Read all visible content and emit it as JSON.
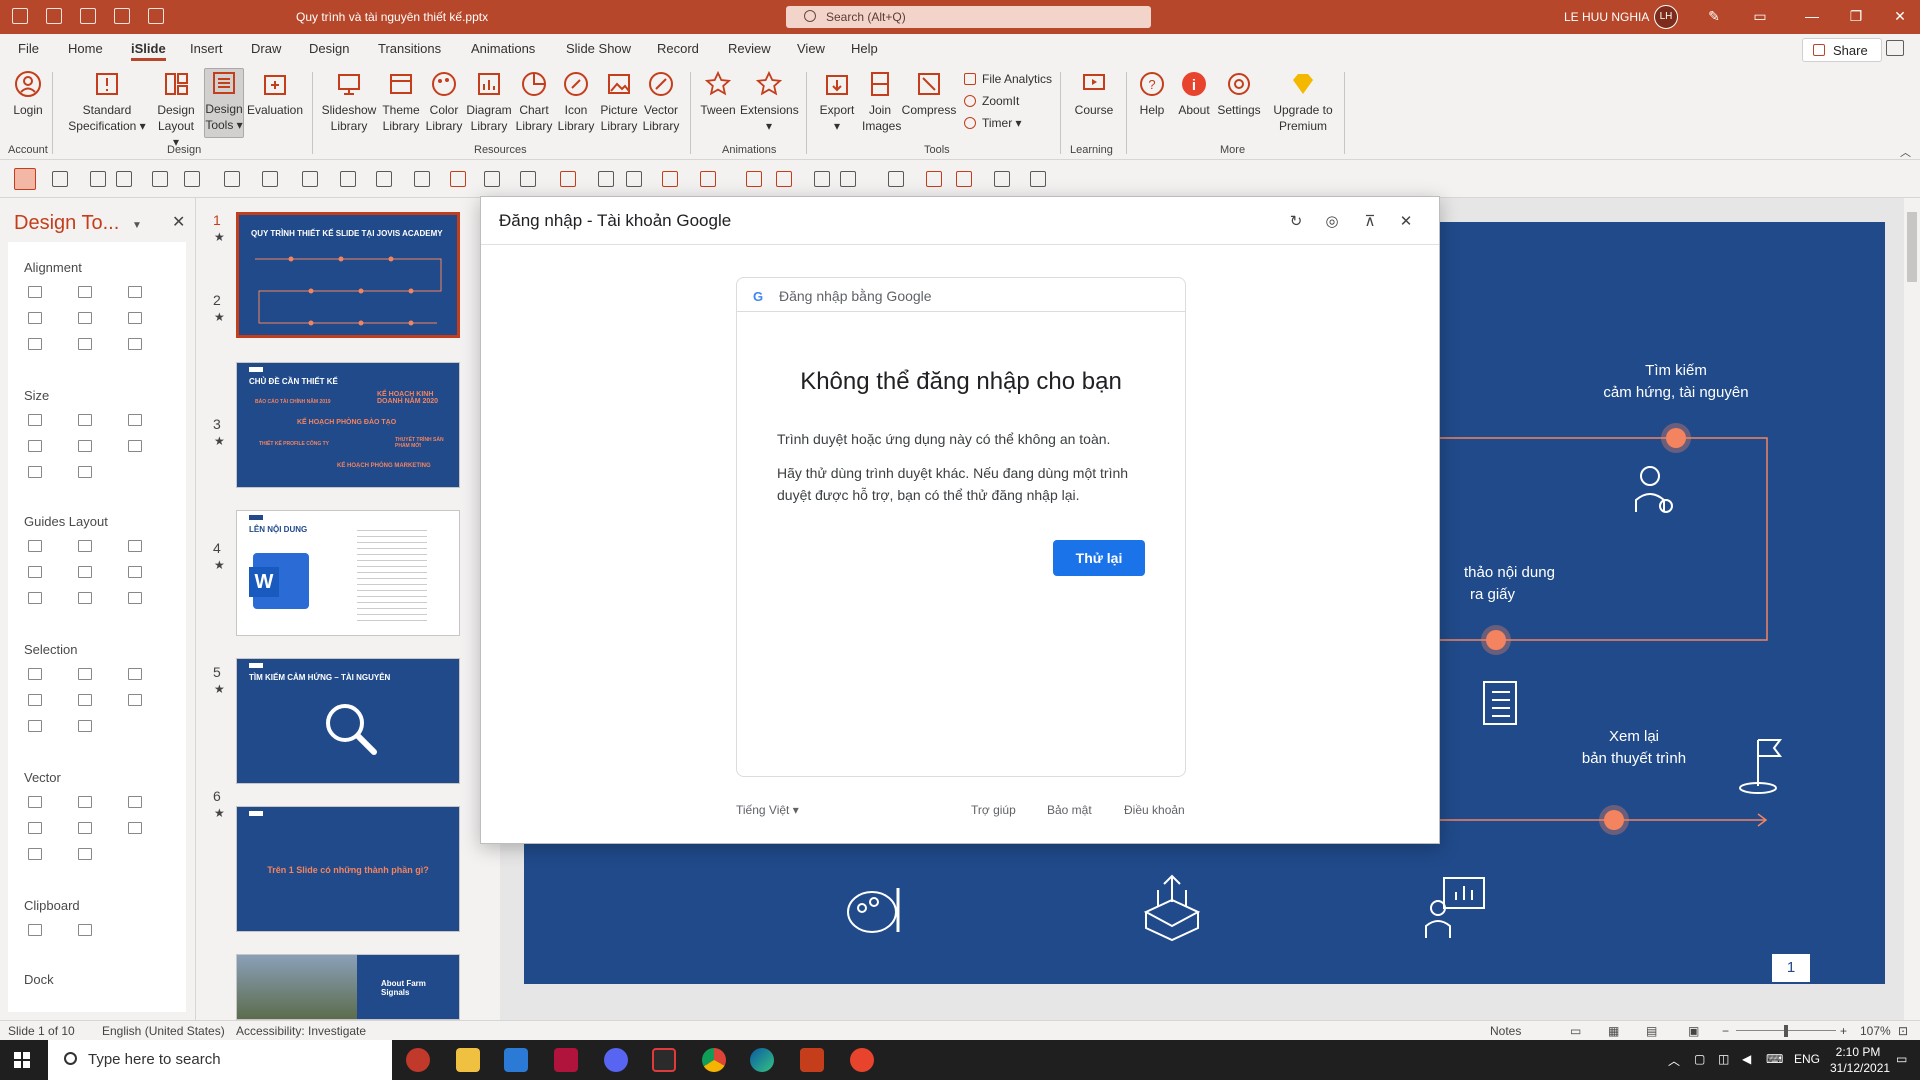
{
  "titlebar": {
    "doc_title": "Quy trình và tài nguyên thiết kế.pptx",
    "search_placeholder": "Search (Alt+Q)",
    "user_name": "LE HUU NGHIA",
    "user_initials": "LH",
    "brand_color": "#b7472a"
  },
  "tabs": [
    "File",
    "Home",
    "iSlide",
    "Insert",
    "Draw",
    "Design",
    "Transitions",
    "Animations",
    "Slide Show",
    "Record",
    "Review",
    "View",
    "Help"
  ],
  "share_label": "Share",
  "ribbon": {
    "account": {
      "login": "Login",
      "group": "Account"
    },
    "design": {
      "standard": "Standard Specification",
      "layout": "Design Layout",
      "tools": "Design Tools",
      "evaluation": "Evaluation",
      "group": "Design"
    },
    "resources": {
      "slideshow": "Slideshow Library",
      "theme": "Theme Library",
      "color": "Color Library",
      "diagram": "Diagram Library",
      "chart": "Chart Library",
      "icon": "Icon Library",
      "picture": "Picture Library",
      "vector": "Vector Library",
      "group": "Resources"
    },
    "animations": {
      "tween": "Tween",
      "extensions": "Extensions",
      "group": "Animations"
    },
    "tools": {
      "export": "Export",
      "join": "Join Images",
      "compress": "Compress",
      "file_analytics": "File Analytics",
      "zoomit": "ZoomIt",
      "timer": "Timer",
      "group": "Tools"
    },
    "learning": {
      "course": "Course",
      "group": "Learning"
    },
    "more": {
      "help": "Help",
      "about": "About",
      "settings": "Settings",
      "upgrade": "Upgrade to Premium",
      "group": "More"
    }
  },
  "design_pane": {
    "title": "Design To...",
    "sections": [
      "Alignment",
      "Size",
      "Guides Layout",
      "Selection",
      "Vector",
      "Clipboard",
      "Dock"
    ]
  },
  "slides": [
    {
      "num": "1",
      "title": "QUY TRÌNH THIẾT KẾ SLIDE TẠI JOVIS ACADEMY"
    },
    {
      "num": "2",
      "title": "CHỦ ĐỀ CẦN THIẾT KẾ",
      "items": [
        "BÁO CÁO TÀI CHÍNH NĂM 2019",
        "KẾ HOẠCH KINH DOANH NĂM 2020",
        "KẾ HOẠCH PHÒNG ĐÀO TẠO",
        "THIẾT KẾ PROFILE CÔNG TY",
        "THUYẾT TRÌNH SẢN PHẨM MỚI",
        "KẾ HOẠCH PHÒNG MARKETING"
      ]
    },
    {
      "num": "3",
      "title": "LÊN NỘI DUNG"
    },
    {
      "num": "4",
      "title": "TÌM KIẾM CẢM HỨNG – TÀI NGUYÊN"
    },
    {
      "num": "5",
      "title": "Trên 1 Slide có những thành phần gì?"
    },
    {
      "num": "6",
      "title": "About Farm Signals"
    }
  ],
  "main_slide": {
    "label_search": [
      "Tìm kiếm",
      "cảm hứng, tài nguyên"
    ],
    "label_draft": [
      "thảo nội dung",
      "ra giấy"
    ],
    "label_review": [
      "Xem lại",
      "bản thuyết trình"
    ],
    "page_number": "1",
    "bg_color": "#204a8a",
    "accent_color": "#f4845f"
  },
  "dialog": {
    "title": "Đăng nhập - Tài khoản Google",
    "card_header": "Đăng nhập bằng Google",
    "heading": "Không thể đăng nhập cho bạn",
    "para1": "Trình duyệt hoặc ứng dụng này có thể không an toàn.",
    "para2": "Hãy thử dùng trình duyệt khác. Nếu đang dùng một trình duyệt được hỗ trợ, bạn có thể thử đăng nhập lại.",
    "retry": "Thử lại",
    "language": "Tiếng Việt",
    "help": "Trợ giúp",
    "privacy": "Bảo mật",
    "terms": "Điều khoản"
  },
  "statusbar": {
    "slide": "Slide 1 of 10",
    "language": "English (United States)",
    "accessibility": "Accessibility: Investigate",
    "notes": "Notes",
    "zoom": "107%"
  },
  "taskbar": {
    "search_placeholder": "Type here to search",
    "lang": "ENG",
    "time": "2:10 PM",
    "date": "31/12/2021"
  }
}
